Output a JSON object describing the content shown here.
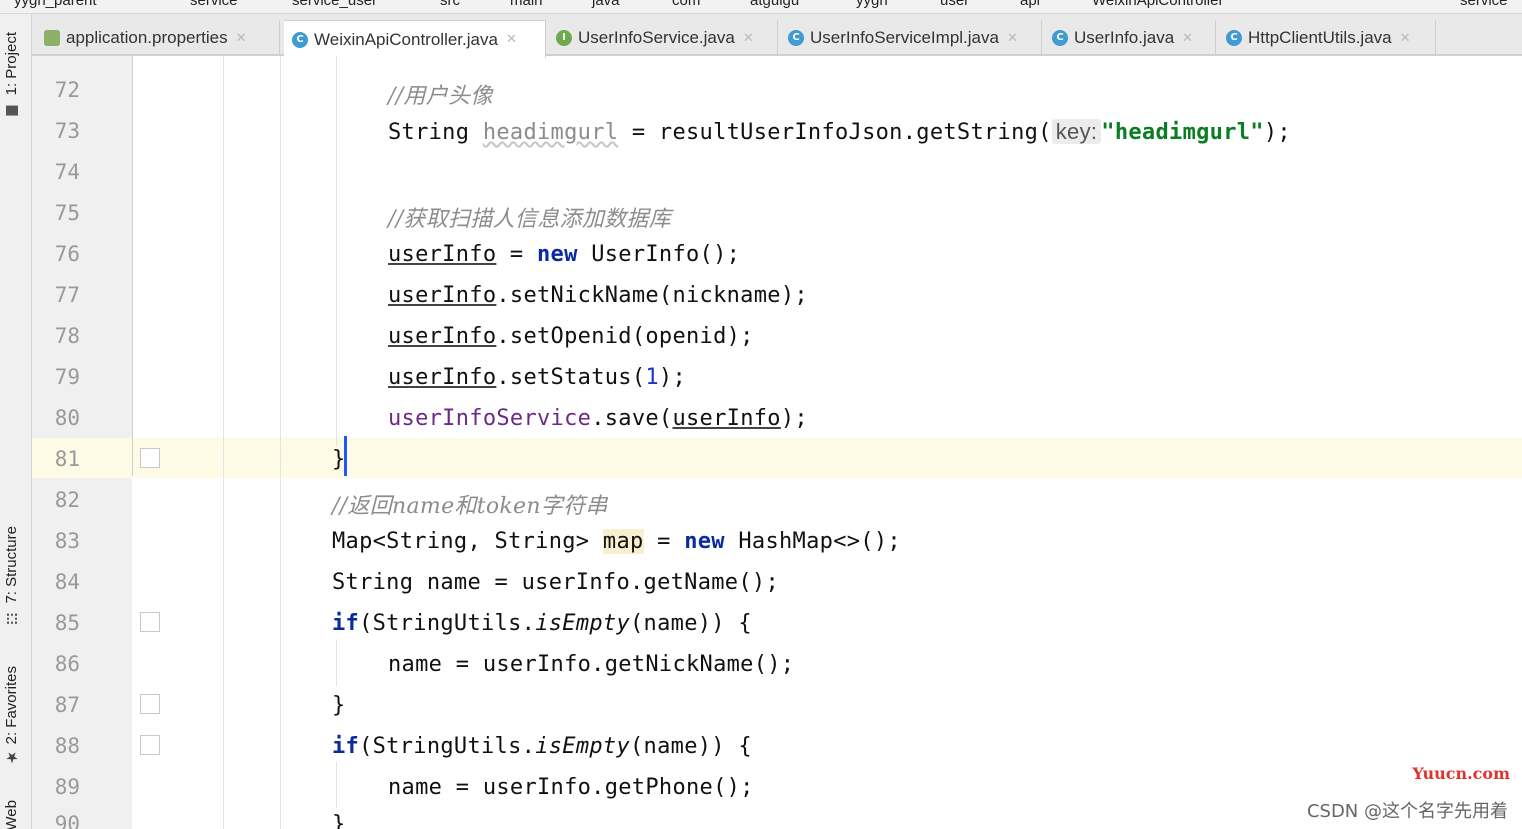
{
  "breadcrumb": [
    "yygh_parent",
    "service",
    "service_user",
    "src",
    "main",
    "java",
    "com",
    "atguigu",
    "yygh",
    "user",
    "api",
    "WeixinApiController",
    "service"
  ],
  "tabs": [
    {
      "label": "application.properties",
      "icon": "properties-file-icon"
    },
    {
      "label": "WeixinApiController.java",
      "icon": "class-icon",
      "active": true
    },
    {
      "label": "UserInfoService.java",
      "icon": "interface-icon"
    },
    {
      "label": "UserInfoServiceImpl.java",
      "icon": "class-icon"
    },
    {
      "label": "UserInfo.java",
      "icon": "class-icon"
    },
    {
      "label": "HttpClientUtils.java",
      "icon": "class-icon"
    }
  ],
  "tool_windows": {
    "project": "1: Project",
    "structure": "7: Structure",
    "favorites": "2: Favorites",
    "web": "Web"
  },
  "line_numbers": [
    "72",
    "73",
    "74",
    "75",
    "76",
    "77",
    "78",
    "79",
    "80",
    "81",
    "82",
    "83",
    "84",
    "85",
    "86",
    "87",
    "88",
    "89",
    "90"
  ],
  "code": {
    "c_avatar": "//用户头像",
    "l73_a": "String ",
    "l73_var": "headimgurl",
    "l73_b": " = resultUserInfoJson.getString(",
    "l73_hint": "key:",
    "l73_str": "\"headimgurl\"",
    "l73_c": ");",
    "c_add_db": "//获取扫描人信息添加数据库",
    "l76_var": "userInfo",
    "l76_a": " = ",
    "l76_kw": "new",
    "l76_b": " UserInfo();",
    "l77_var": "userInfo",
    "l77_a": ".setNickName(nickname);",
    "l78_var": "userInfo",
    "l78_a": ".setOpenid(openid);",
    "l79_var": "userInfo",
    "l79_a": ".setStatus(",
    "l79_num": "1",
    "l79_b": ");",
    "l80_fld": "userInfoService",
    "l80_a": ".save(",
    "l80_var": "userInfo",
    "l80_b": ");",
    "l81": "}",
    "c_return": "//返回name和token字符串",
    "l83_a": "Map<String, String> ",
    "l83_var": "map",
    "l83_b": " = ",
    "l83_kw": "new",
    "l83_c": " HashMap<>();",
    "l84": "String name = userInfo.getName();",
    "l85_kw": "if",
    "l85_a": "(StringUtils.",
    "l85_it": "isEmpty",
    "l85_b": "(name)) {",
    "l86": "name = userInfo.getNickName();",
    "l87": "}",
    "l88_kw": "if",
    "l88_a": "(StringUtils.",
    "l88_it": "isEmpty",
    "l88_b": "(name)) {",
    "l89": "name = userInfo.getPhone();",
    "l90": "}"
  },
  "watermark": {
    "site": "Yuucn.com",
    "author": "CSDN @这个名字先用着"
  },
  "colors": {
    "keyword": "#0b2aa0",
    "string": "#0a7d25",
    "comment": "#8c8c8c",
    "caret_line": "#fdfbe5"
  }
}
